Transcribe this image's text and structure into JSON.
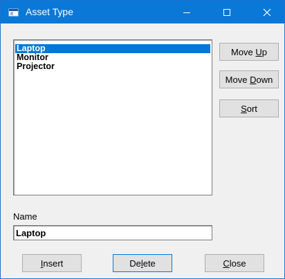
{
  "window": {
    "title": "Asset Type",
    "min_glyph": "—",
    "max_glyph": "☐",
    "close_glyph": "✕"
  },
  "list": {
    "items": [
      "Laptop",
      "Monitor",
      "Projector"
    ],
    "selected_index": 0
  },
  "side_buttons": {
    "move_up": {
      "pre": "Move ",
      "u": "U",
      "post": "p"
    },
    "move_down": {
      "pre": "Move ",
      "u": "D",
      "post": "own"
    },
    "sort": {
      "pre": "",
      "u": "S",
      "post": "ort"
    }
  },
  "name": {
    "label": "Name",
    "value": "Laptop"
  },
  "bottom_buttons": {
    "insert": {
      "pre": "",
      "u": "I",
      "post": "nsert"
    },
    "delete": {
      "pre": "De",
      "u": "l",
      "post": "ete"
    },
    "close": {
      "pre": "",
      "u": "C",
      "post": "lose"
    }
  },
  "colors": {
    "titlebar": "#0a78d7",
    "selection": "#0078d7",
    "face": "#f0f0f0"
  }
}
